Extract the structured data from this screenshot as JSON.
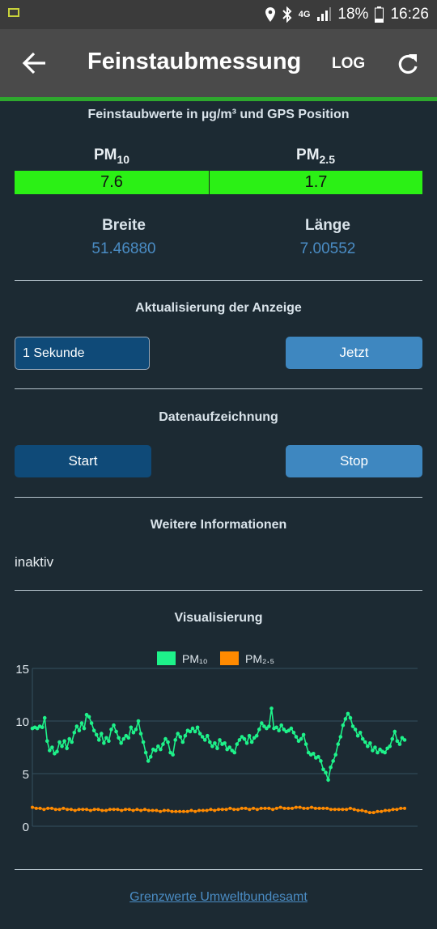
{
  "status_bar": {
    "network": "4G",
    "battery": "18%",
    "time": "16:26"
  },
  "app_bar": {
    "title": "Feinstaubmessung",
    "log_label": "LOG"
  },
  "measurement": {
    "subtitle": "Feinstaubwerte in µg/m³ und GPS Position",
    "pm10_label": "PM",
    "pm10_sub": "10",
    "pm25_label": "PM",
    "pm25_sub": "2.5",
    "pm10_value": "7.6",
    "pm25_value": "1.7",
    "lat_label": "Breite",
    "lat_value": "51.46880",
    "lon_label": "Länge",
    "lon_value": "7.00552",
    "value_color": "#2bf015"
  },
  "refresh": {
    "heading": "Aktualisierung der Anzeige",
    "interval": "1 Sekunde",
    "now_label": "Jetzt"
  },
  "recording": {
    "heading": "Datenaufzeichnung",
    "start_label": "Start",
    "stop_label": "Stop"
  },
  "info": {
    "heading": "Weitere Informationen",
    "status": "inaktiv"
  },
  "visualization": {
    "heading": "Visualisierung"
  },
  "footer": {
    "link": "Grenzwerte Umweltbundesamt"
  },
  "chart_data": {
    "type": "line",
    "ylim": [
      0,
      15
    ],
    "yticks": [
      "0",
      "5",
      "10",
      "15"
    ],
    "legend_position": "top",
    "series": [
      {
        "name": "PM₁₀",
        "color": "#1ef28a",
        "values": [
          9.3,
          9.4,
          9.3,
          9.5,
          9.4,
          10.3,
          8.1,
          7.2,
          7.5,
          6.9,
          7.1,
          8.0,
          7.6,
          8.1,
          7.4,
          8.3,
          8.0,
          8.9,
          9.5,
          9.1,
          9.8,
          9.3,
          10.6,
          10.4,
          9.8,
          9.1,
          8.7,
          8.2,
          8.8,
          7.9,
          8.4,
          8.1,
          9.2,
          9.6,
          9.0,
          8.4,
          7.9,
          8.3,
          8.6,
          8.4,
          9.4,
          8.9,
          9.2,
          10.0,
          8.8,
          8.0,
          7.0,
          6.2,
          6.6,
          7.3,
          7.2,
          7.6,
          7.3,
          7.8,
          8.3,
          8.0,
          7.0,
          6.8,
          8.2,
          8.8,
          8.5,
          8.0,
          8.6,
          9.1,
          9.0,
          9.3,
          9.0,
          9.4,
          8.8,
          8.5,
          8.2,
          8.6,
          8.0,
          7.6,
          7.9,
          7.4,
          8.2,
          7.8,
          7.9,
          7.3,
          7.5,
          7.2,
          7.0,
          7.8,
          8.2,
          8.5,
          8.3,
          7.9,
          8.6,
          8.0,
          8.4,
          8.6,
          9.2,
          9.8,
          9.5,
          9.3,
          9.5,
          11.2,
          9.3,
          9.4,
          9.1,
          9.6,
          9.2,
          9.0,
          9.1,
          9.3,
          8.9,
          8.5,
          8.1,
          8.3,
          8.7,
          7.8,
          7.0,
          6.8,
          6.9,
          6.5,
          6.6,
          6.2,
          5.4,
          5.1,
          4.4,
          5.6,
          6.2,
          6.8,
          7.8,
          8.5,
          9.6,
          10.2,
          10.7,
          10.3,
          9.5,
          9.2,
          8.6,
          8.9,
          8.3,
          8.0,
          7.6,
          7.9,
          7.2,
          7.5,
          7.0,
          7.3,
          7.1,
          7.0,
          7.4,
          7.6,
          8.3,
          9.0,
          8.1,
          7.8,
          8.4,
          8.2
        ]
      },
      {
        "name": "PM₂.₅",
        "color": "#ff8a00",
        "values": [
          1.8,
          1.7,
          1.7,
          1.6,
          1.7,
          1.7,
          1.6,
          1.6,
          1.7,
          1.6,
          1.6,
          1.5,
          1.6,
          1.6,
          1.6,
          1.5,
          1.6,
          1.6,
          1.5,
          1.5,
          1.6,
          1.6,
          1.6,
          1.5,
          1.6,
          1.6,
          1.5,
          1.6,
          1.5,
          1.6,
          1.5,
          1.5,
          1.5,
          1.4,
          1.5,
          1.5,
          1.4,
          1.4,
          1.4,
          1.4,
          1.4,
          1.5,
          1.4,
          1.5,
          1.5,
          1.5,
          1.6,
          1.5,
          1.6,
          1.6,
          1.6,
          1.7,
          1.6,
          1.6,
          1.7,
          1.7,
          1.6,
          1.7,
          1.6,
          1.7,
          1.7,
          1.7,
          1.6,
          1.7,
          1.8,
          1.7,
          1.7,
          1.7,
          1.8,
          1.8,
          1.7,
          1.7,
          1.8,
          1.7,
          1.7,
          1.7,
          1.7,
          1.6,
          1.6,
          1.6,
          1.6,
          1.6,
          1.7,
          1.6,
          1.5,
          1.5,
          1.4,
          1.3,
          1.3,
          1.4,
          1.4,
          1.5,
          1.5,
          1.6,
          1.6,
          1.7,
          1.7
        ]
      }
    ]
  }
}
